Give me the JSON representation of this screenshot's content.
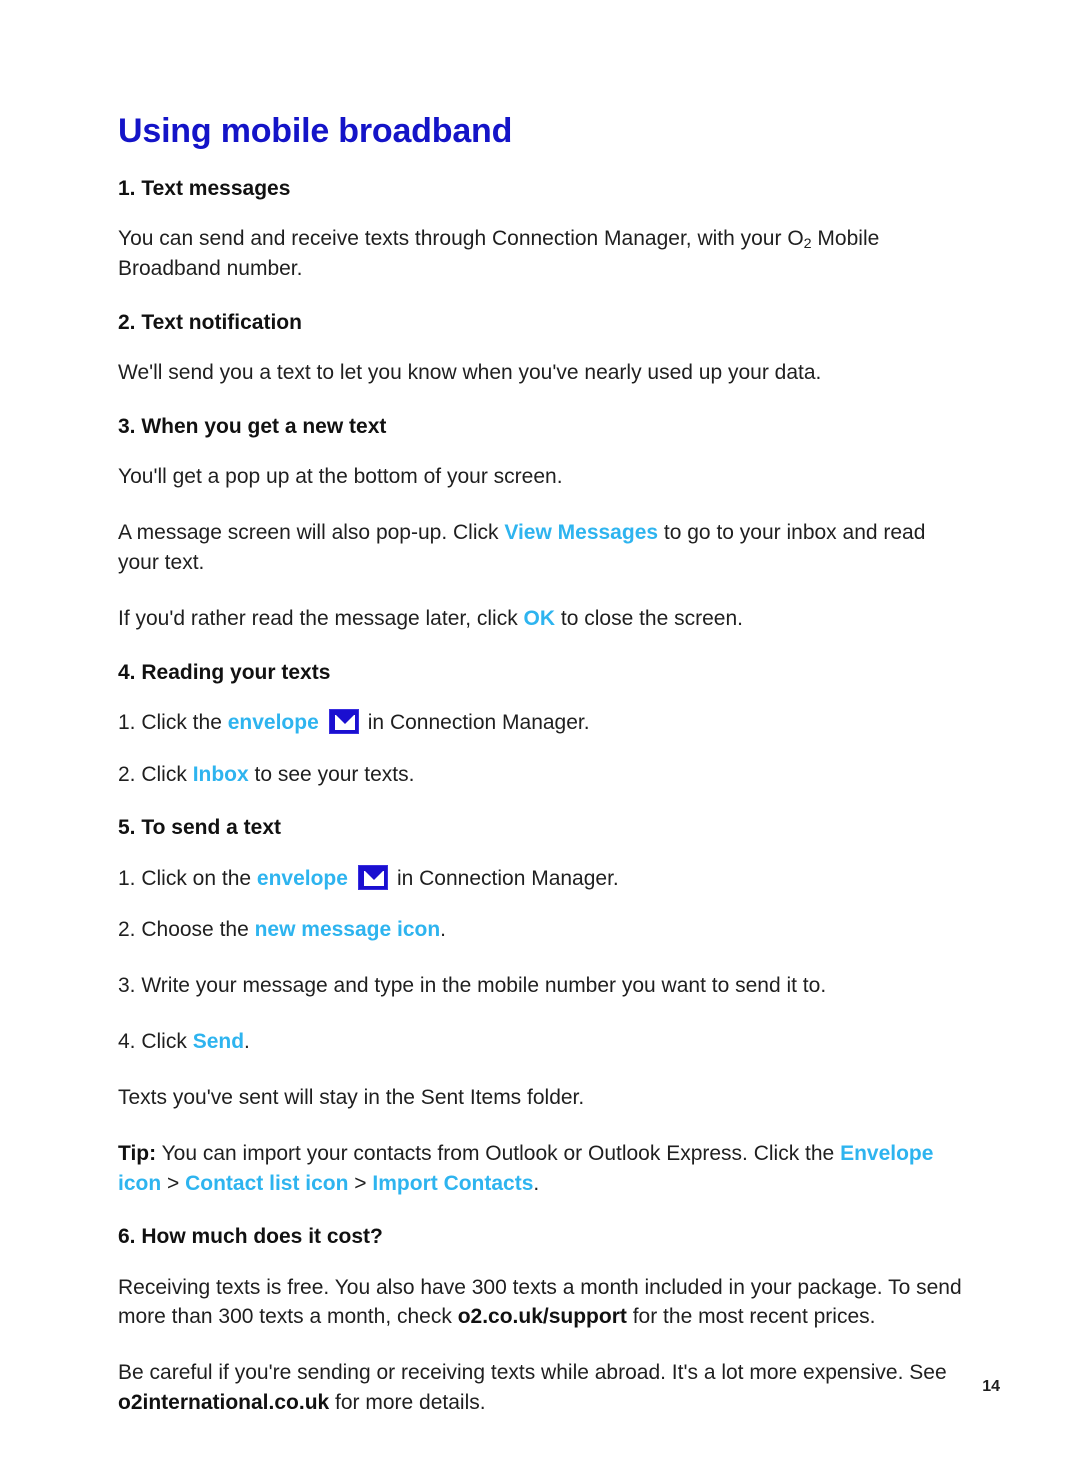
{
  "document": {
    "title": "Using mobile broadband",
    "page_number": "14",
    "colors": {
      "title_blue": "#1414c8",
      "link_cyan": "#2eb4ef",
      "body_black": "#1f1f1f",
      "icon_blue": "#1a0fd0",
      "background": "#ffffff"
    }
  },
  "sections": {
    "s1": {
      "heading": "1. Text messages",
      "para_1_a": "You can send and receive texts through Connection Manager, with your O",
      "para_1_sub": "2",
      "para_1_b": " Mobile Broadband number."
    },
    "s2": {
      "heading": "2. Text notification",
      "para_1": "We'll send you a text to let you know when you've nearly used up your data."
    },
    "s3": {
      "heading": "3. When you get a new text",
      "para_1": "You'll get a pop up at the bottom of your screen.",
      "para_2_a": "A message screen will also pop-up. Click ",
      "para_2_link": "View Messages",
      "para_2_b": " to go to your inbox and read your text.",
      "para_3_a": "If you'd rather read the message later, click ",
      "para_3_link": "OK",
      "para_3_b": " to close the screen."
    },
    "s4": {
      "heading": "4. Reading your texts",
      "item_1_a": "1. Click the ",
      "item_1_link": "envelope",
      "item_1_icon": "envelope-icon",
      "item_1_b": "in Connection Manager.",
      "item_2_a": "2. Click ",
      "item_2_link": "Inbox",
      "item_2_b": " to see your texts."
    },
    "s5": {
      "heading": "5. To send a text",
      "item_1_a": "1. Click on the ",
      "item_1_link": "envelope",
      "item_1_icon": "envelope-icon",
      "item_1_b": "in Connection Manager.",
      "item_2_a": "2. Choose the ",
      "item_2_link": "new message icon",
      "item_2_b": ".",
      "item_3": "3. Write your message and type in the mobile number you want to send it to.",
      "item_4_a": "4. Click ",
      "item_4_link": "Send",
      "item_4_b": ".",
      "para_sent": "Texts you've sent will stay in the Sent Items folder.",
      "tip_label": "Tip:",
      "tip_text": " You can import your contacts from Outlook or Outlook Express. Click the ",
      "tip_link_1": "Envelope icon",
      "tip_sep_1": " > ",
      "tip_link_2": "Contact list icon",
      "tip_sep_2": " > ",
      "tip_link_3": "Import Contacts",
      "tip_end": "."
    },
    "s6": {
      "heading": "6. How much does it cost?",
      "para_1_a": "Receiving texts is free. You also have 300 texts a month included in your package. To send more than 300 texts a month, check ",
      "para_1_bold": "o2.co.uk/support",
      "para_1_b": " for the most recent prices.",
      "para_2_a": "Be careful if you're sending or receiving texts while abroad. It's a lot more expensive. See ",
      "para_2_bold": "o2international.co.uk",
      "para_2_b": " for more details."
    }
  }
}
